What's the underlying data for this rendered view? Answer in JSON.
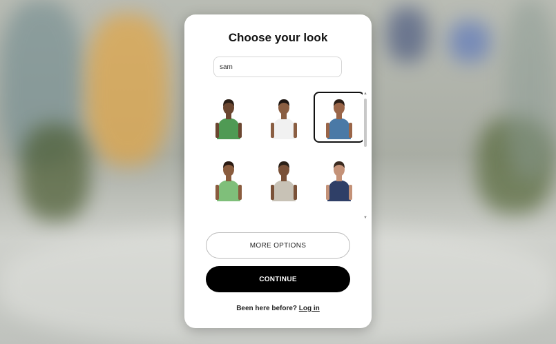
{
  "modal": {
    "title": "Choose your look",
    "name_input_value": "sam",
    "avatars": [
      {
        "icon": "avatar-green-vest-icon",
        "shirt": "#4f9a54",
        "skin": "#6b4630",
        "hair": "#2a1d15",
        "selected": false
      },
      {
        "icon": "avatar-white-top-icon",
        "shirt": "#f1f1f1",
        "skin": "#8a5e42",
        "hair": "#1d1511",
        "selected": false
      },
      {
        "icon": "avatar-blue-shirt-icon",
        "shirt": "#4a79a6",
        "skin": "#9a6548",
        "hair": "#2b1d15",
        "selected": true
      },
      {
        "icon": "avatar-green-top-icon",
        "shirt": "#7fbf7a",
        "skin": "#8a5c3e",
        "hair": "#2a1a12",
        "selected": false
      },
      {
        "icon": "avatar-grey-vest-icon",
        "shirt": "#c8c2b6",
        "skin": "#7a5138",
        "hair": "#2b2017",
        "selected": false
      },
      {
        "icon": "avatar-navy-top-icon",
        "shirt": "#2f3f67",
        "skin": "#c49278",
        "hair": "#3a2a1f",
        "selected": false
      },
      {
        "icon": "avatar-partial-1-icon",
        "shirt": "#333333",
        "skin": "#5e3c28",
        "hair": "#1a1410",
        "selected": false
      },
      {
        "icon": "avatar-partial-2-icon",
        "shirt": "#888888",
        "skin": "#d7b9a2",
        "hair": "#a7a7a7",
        "selected": false
      },
      {
        "icon": "avatar-partial-3-icon",
        "shirt": "#333333",
        "skin": "#4b3022",
        "hair": "#1a1410",
        "selected": false
      }
    ],
    "more_options_label": "MORE OPTIONS",
    "continue_label": "CONTINUE",
    "footer_text": "Been here before?",
    "login_link": "Log in"
  }
}
